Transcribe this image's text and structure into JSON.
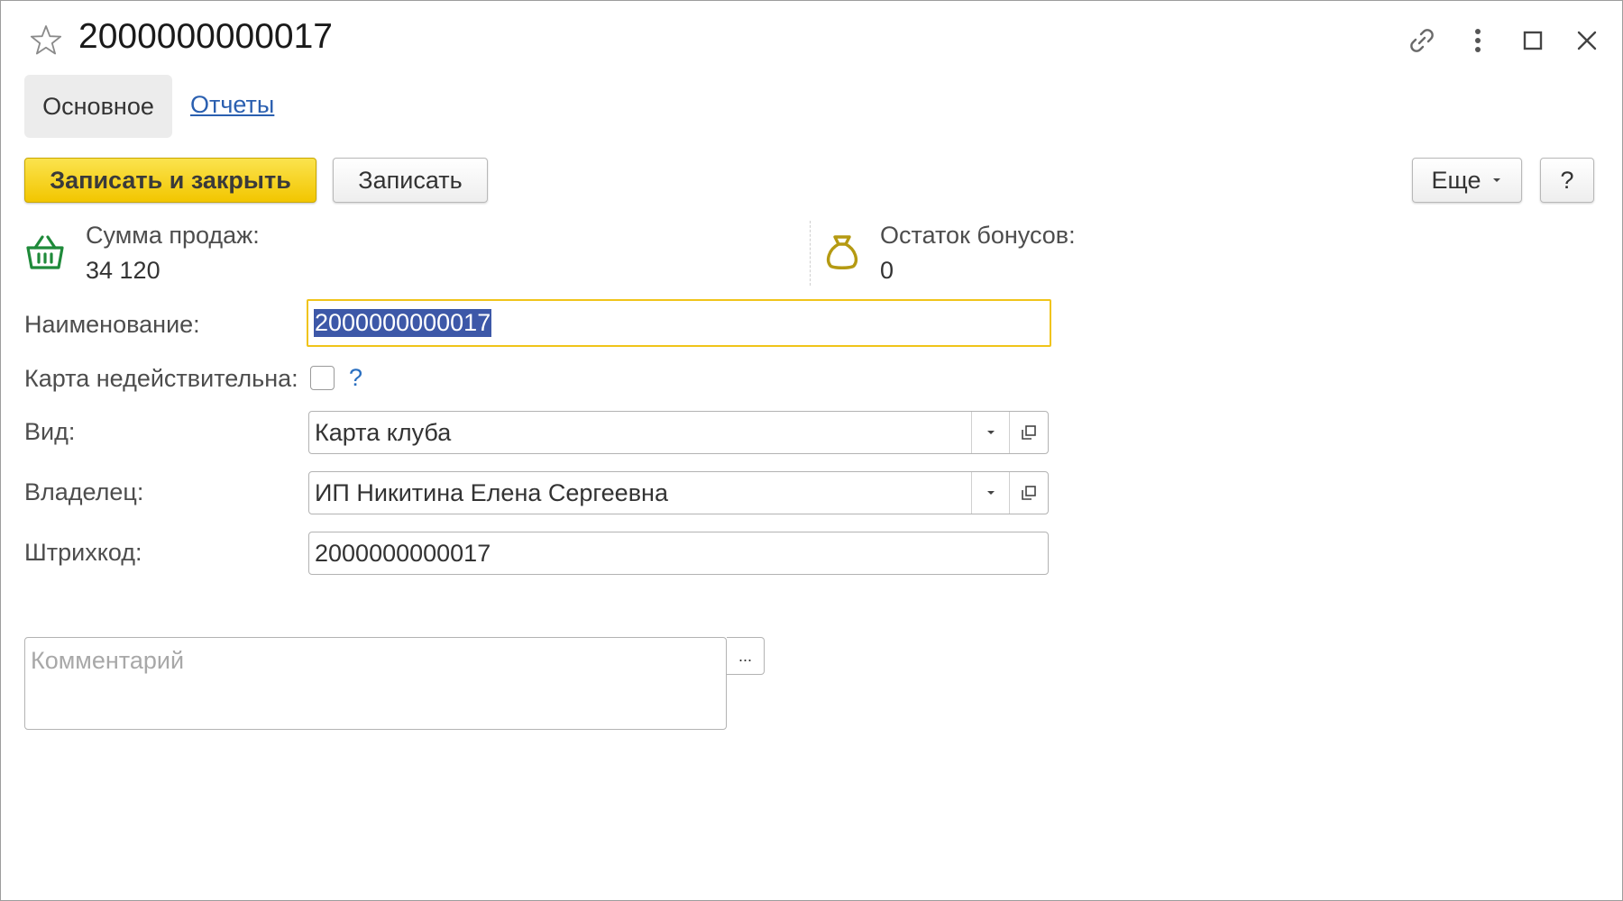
{
  "window": {
    "title": "2000000000017"
  },
  "tabs": [
    {
      "label": "Основное",
      "active": true
    },
    {
      "label": "Отчеты",
      "active": false
    }
  ],
  "toolbar": {
    "save_close_label": "Записать и закрыть",
    "save_label": "Записать",
    "more_label": "Еще",
    "help_label": "?"
  },
  "summary": {
    "sales_label": "Сумма продаж:",
    "sales_value": "34 120",
    "sales_icon": "basket-icon",
    "bonus_label": "Остаток бонусов:",
    "bonus_value": "0",
    "bonus_icon": "money-bag-icon"
  },
  "form": {
    "name_label": "Наименование:",
    "name_value": "2000000000017",
    "invalid_label": "Карта недействительна:",
    "invalid_checked": false,
    "invalid_help": "?",
    "kind_label": "Вид:",
    "kind_value": "Карта клуба",
    "owner_label": "Владелец:",
    "owner_value": "ИП Никитина Елена Сергеевна",
    "barcode_label": "Штрихкод:",
    "barcode_value": "2000000000017",
    "comment_placeholder": "Комментарий",
    "comment_value": "",
    "comment_button": "..."
  },
  "colors": {
    "primary_button": "#f5cc0a",
    "link": "#2a5fb0",
    "basket_icon": "#1f8a3a",
    "bag_icon": "#b59a12",
    "focus_border": "#f0c419",
    "selection": "#3d58a8"
  }
}
